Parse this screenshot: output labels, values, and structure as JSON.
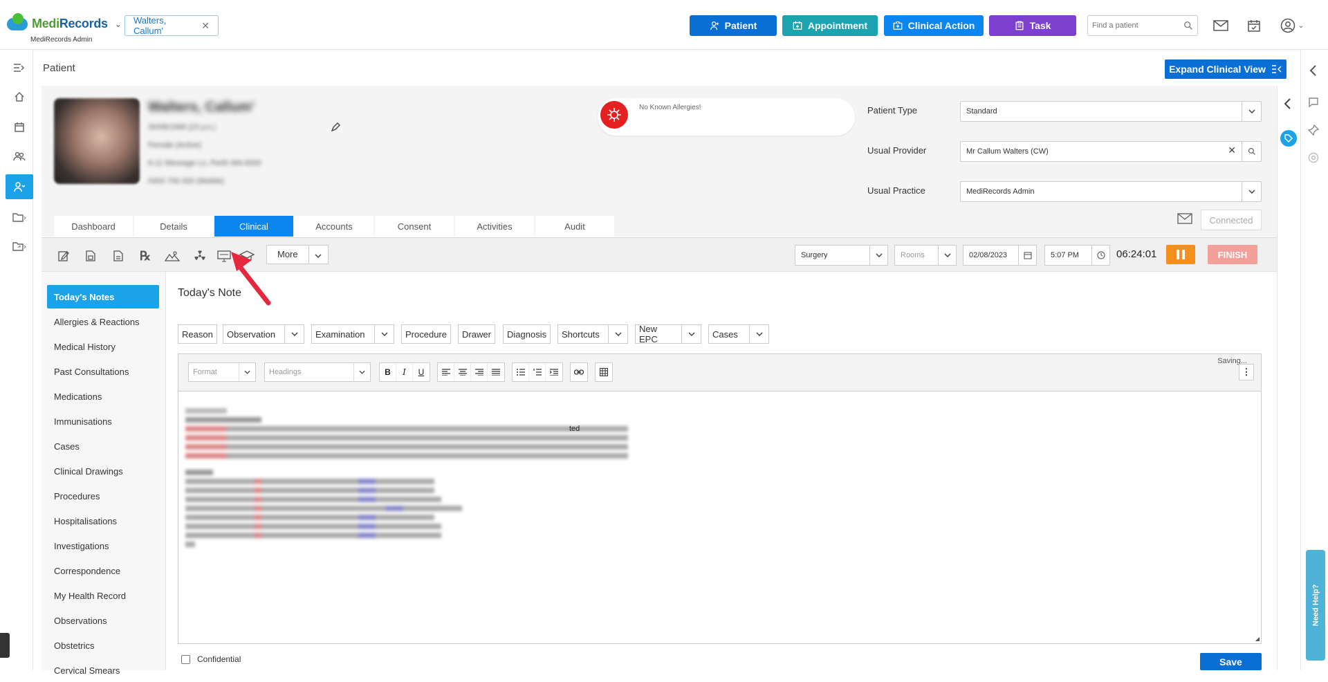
{
  "header": {
    "brand_part1": "Medi",
    "brand_part2": "Records",
    "brand_sub": "MediRecords Admin",
    "patient_chip": "Walters, Callum'",
    "buttons": {
      "patient": "Patient",
      "appointment": "Appointment",
      "clinical_action": "Clinical Action",
      "task": "Task"
    },
    "search_placeholder": "Find a patient",
    "colors": {
      "patient": "#0a6fd4",
      "appointment": "#1ba3b0",
      "clinical_action": "#0a86ee",
      "task": "#7c3fcf"
    }
  },
  "page": {
    "heading": "Patient",
    "expand_button": "Expand Clinical View"
  },
  "patient": {
    "name": "Walters, Callum'",
    "lines": [
      "30/08/1999 (23 y.o.)",
      "Female (Active)",
      "6-11 Message Ln, Perth WA 6000",
      "0400 700 000 (Mobile)"
    ],
    "allergies": "No Known Allergies!",
    "fields": {
      "type_label": "Patient Type",
      "type_value": "Standard",
      "provider_label": "Usual Provider",
      "provider_value": "Mr Callum Walters (CW)",
      "practice_label": "Usual Practice",
      "practice_value": "MediRecords Admin"
    }
  },
  "tabs": [
    "Dashboard",
    "Details",
    "Clinical",
    "Accounts",
    "Consent",
    "Activities",
    "Audit"
  ],
  "connected": "Connected",
  "toolbar": {
    "more": "More",
    "location": "Surgery",
    "rooms": "Rooms",
    "date": "02/08/2023",
    "time": "5:07 PM",
    "timer": "06:24:01",
    "finish": "FINISH"
  },
  "clinical_nav": [
    "Today's Notes",
    "Allergies & Reactions",
    "Medical History",
    "Past Consultations",
    "Medications",
    "Immunisations",
    "Cases",
    "Clinical Drawings",
    "Procedures",
    "Hospitalisations",
    "Investigations",
    "Correspondence",
    "My Health Record",
    "Observations",
    "Obstetrics",
    "Cervical Smears"
  ],
  "note": {
    "title": "Today's Note",
    "buttons": [
      "Reason",
      "Observation",
      "Examination",
      "Procedure",
      "Drawer",
      "Diagnosis",
      "Shortcuts",
      "New EPC",
      "Cases"
    ],
    "format": "Format",
    "headings": "Headings",
    "saving": "Saving...",
    "visible_fragment": "ted",
    "confidential": "Confidential",
    "save": "Save"
  },
  "help": "Need Help?"
}
